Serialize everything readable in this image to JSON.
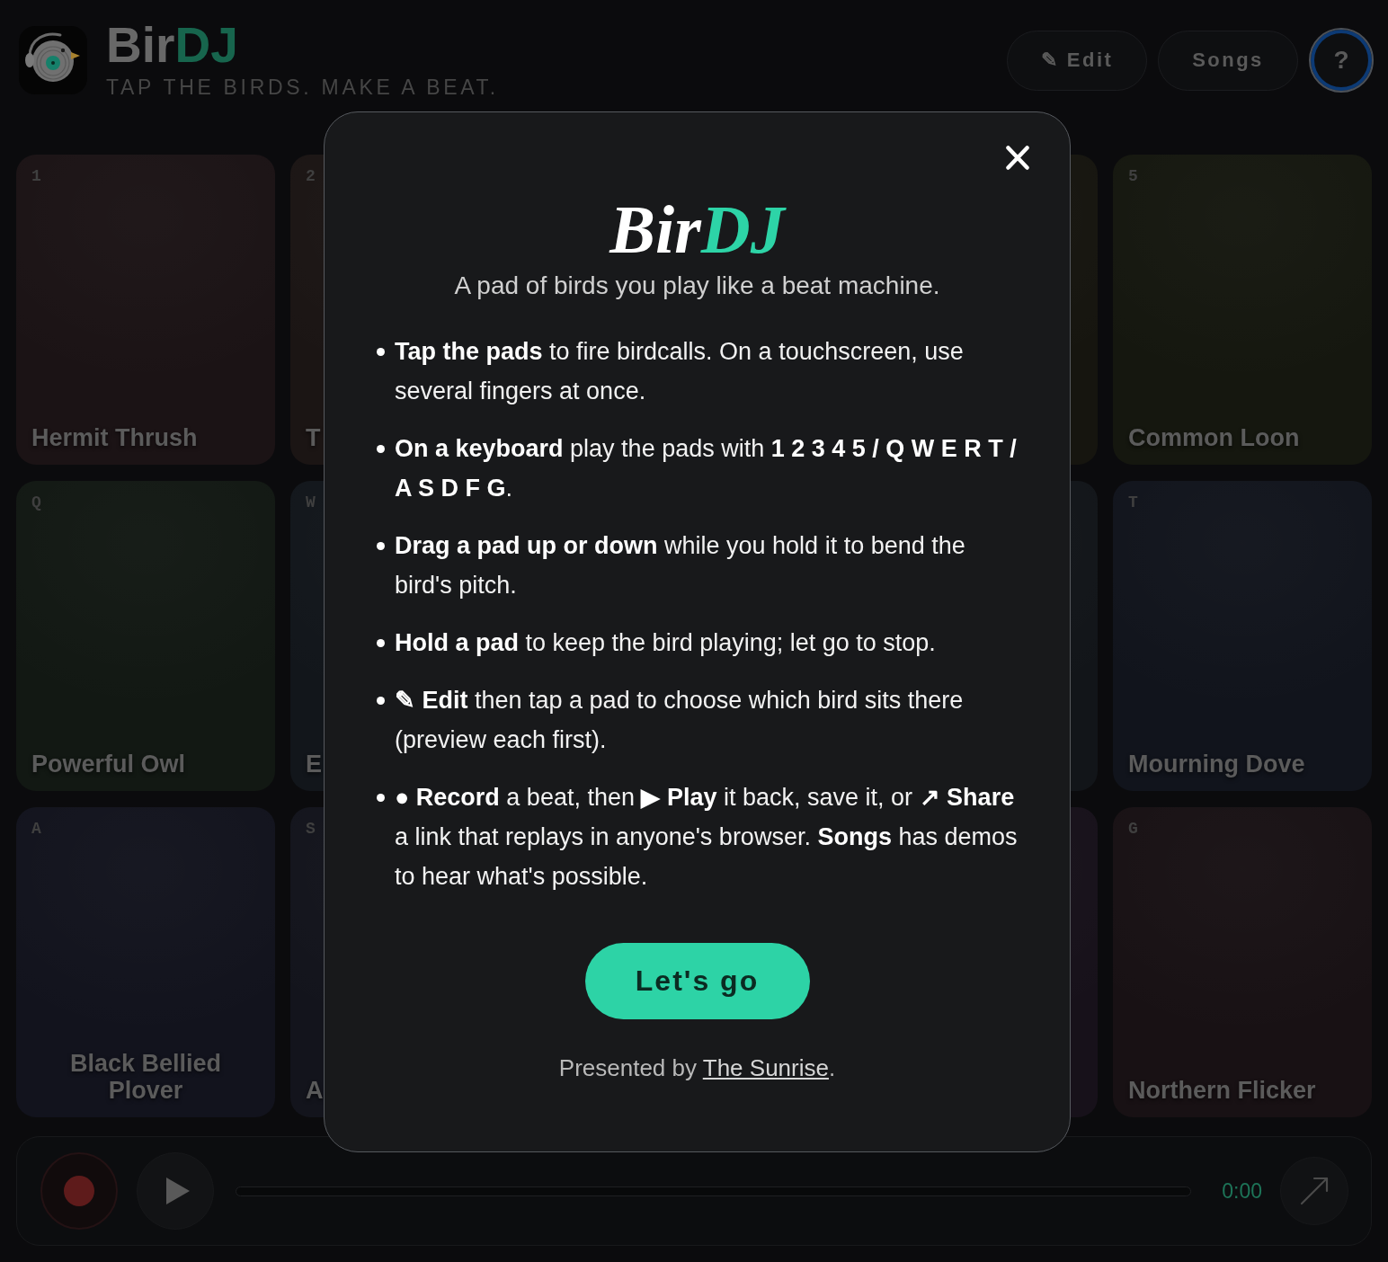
{
  "header": {
    "title": {
      "main": "Bir",
      "accent": "DJ"
    },
    "tagline": "TAP THE BIRDS. MAKE A BEAT.",
    "buttons": [
      {
        "kind": "edit",
        "label": "✎ Edit",
        "active": false
      },
      {
        "kind": "songs",
        "label": "Songs",
        "active": false
      },
      {
        "kind": "help",
        "label": "?",
        "active": true
      }
    ]
  },
  "pads_left": [
    {
      "key": "1",
      "name": "Hermit Thrush",
      "color": "#1b1315"
    },
    {
      "key": "2",
      "name": "T",
      "color": "#1b1514"
    },
    {
      "key": "Q",
      "name": "Powerful Owl",
      "color": "#121813"
    },
    {
      "key": "W",
      "name": "E",
      "color": "#12161b"
    },
    {
      "key": "A",
      "name": "Black Bellied Plover",
      "color": "#12131d"
    },
    {
      "key": "S",
      "name": "A",
      "color": "#13141c"
    }
  ],
  "pads_right": [
    {
      "color": "#16150f"
    },
    {
      "key": "5",
      "name": "Common Loon",
      "color": "#15170f"
    },
    {
      "color": "#121519"
    },
    {
      "key": "T",
      "name": "Mourning Dove",
      "color": "#11141c"
    },
    {
      "color": "#17111a"
    },
    {
      "key": "G",
      "name": "Northern Flicker",
      "color": "#181114"
    }
  ],
  "transport": {
    "progress": {
      "level": 0
    },
    "time": "0:00"
  },
  "dialog": {
    "title": {
      "main": "Bir",
      "accent": "DJ"
    },
    "subtitle": "A pad of birds you play like a beat machine.",
    "items": [
      "**Tap the pads** to fire birdcalls. On a touchscreen, use several fingers at once.",
      "**On a keyboard** play the pads with **1 2 3 4 5 / Q W E R T / A S D F G**.",
      "**Drag a pad up or down** while you hold it to bend the bird's pitch.",
      "**Hold a pad** to keep the bird playing; let go to stop.",
      "**✎ Edit** then tap a pad to choose which bird sits there (preview each first).",
      "**● Record** a beat, then **▶ Play** it back, save it, or **↗ Share** a link that replays in anyone's browser. **Songs** has demos to hear what's possible."
    ],
    "button": "Let's go",
    "credit": {
      "prefix": "Presented by ",
      "link": "The Sunrise",
      "suffix": "."
    }
  }
}
